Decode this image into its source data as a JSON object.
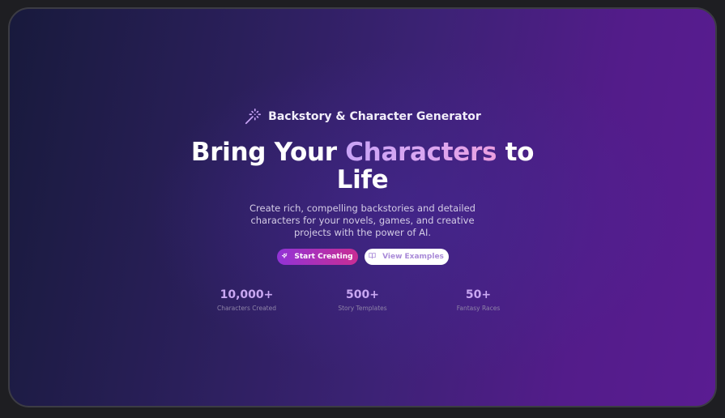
{
  "badge": {
    "icon": "magic-wand-icon",
    "text": "Backstory & Character Generator"
  },
  "hero": {
    "title_before": "Bring Your ",
    "title_accent": "Characters",
    "title_after": " to Life",
    "subtitle": "Create rich, compelling backstories and detailed characters for your novels, games, and creative projects with the power of AI."
  },
  "buttons": {
    "primary": {
      "icon": "sparkle-icon",
      "label": "Start Creating"
    },
    "secondary": {
      "icon": "book-open-icon",
      "label": "View Examples"
    }
  },
  "stats": [
    {
      "value": "10,000+",
      "label": "Characters Created"
    },
    {
      "value": "500+",
      "label": "Story Templates"
    },
    {
      "value": "50+",
      "label": "Fantasy Races"
    }
  ],
  "colors": {
    "accent": "#c9a4f7",
    "button_gradient_start": "#9233d6",
    "button_gradient_end": "#c92d94"
  }
}
